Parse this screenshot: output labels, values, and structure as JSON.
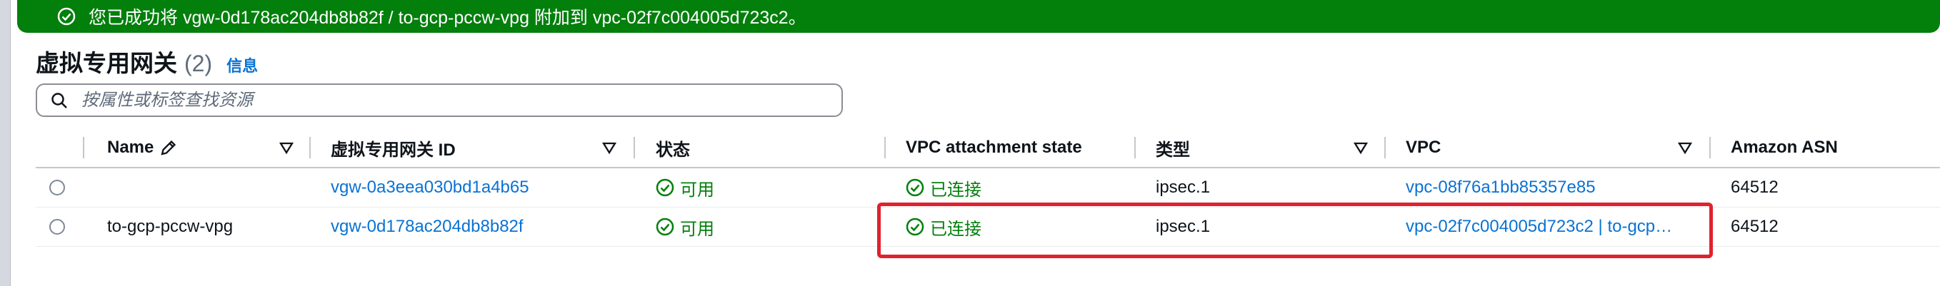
{
  "flash": {
    "message": "您已成功将 vgw-0d178ac204db8b82f / to-gcp-pccw-vpg 附加到 vpc-02f7c004005d723c2。"
  },
  "header": {
    "title": "虚拟专用网关",
    "count": "(2)",
    "info": "信息"
  },
  "search": {
    "placeholder": "按属性或标签查找资源"
  },
  "columns": {
    "name": "Name",
    "gateway_id": "虚拟专用网关 ID",
    "state": "状态",
    "vpc_attachment_state": "VPC attachment state",
    "type": "类型",
    "vpc": "VPC",
    "asn": "Amazon ASN"
  },
  "rows": [
    {
      "name": "",
      "gateway_id": "vgw-0a3eea030bd1a4b65",
      "state": "可用",
      "attachment": "已连接",
      "type": "ipsec.1",
      "vpc": "vpc-08f76a1bb85357e85",
      "asn": "64512"
    },
    {
      "name": "to-gcp-pccw-vpg",
      "gateway_id": "vgw-0d178ac204db8b82f",
      "state": "可用",
      "attachment": "已连接",
      "type": "ipsec.1",
      "vpc": "vpc-02f7c004005d723c2 | to-gcp…",
      "asn": "64512"
    }
  ],
  "colors": {
    "success": "#037f0c",
    "link": "#0972d3",
    "highlight": "#e0212f"
  }
}
